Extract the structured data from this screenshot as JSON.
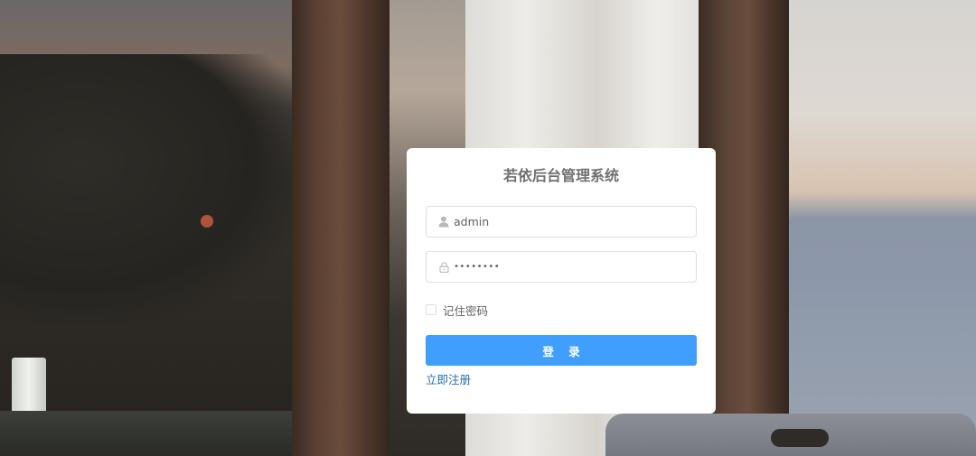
{
  "login": {
    "title": "若依后台管理系统",
    "username": {
      "value": "admin",
      "icon": "user-icon"
    },
    "password": {
      "value": "••••••••",
      "icon": "lock-icon"
    },
    "remember_me": {
      "label": "记住密码",
      "checked": false
    },
    "submit_label": "登 录",
    "register_link": "立即注册"
  },
  "colors": {
    "primary": "#409eff",
    "link": "#1f6fb5",
    "card_bg": "#ffffff",
    "title_text": "#707070"
  }
}
